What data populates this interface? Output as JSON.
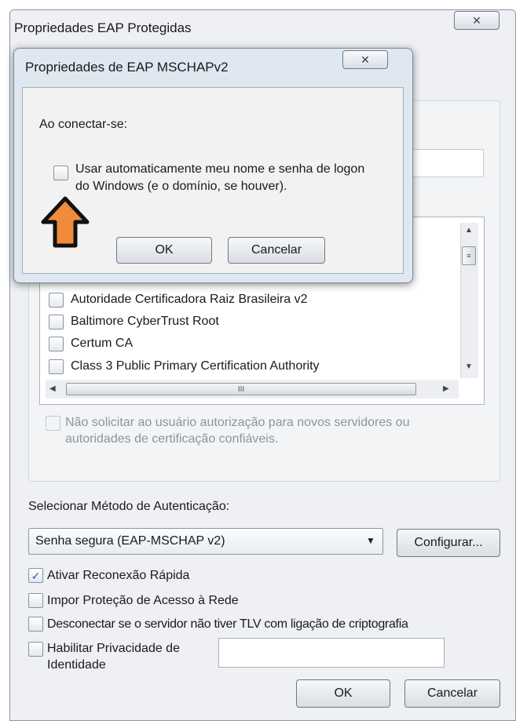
{
  "outer_dialog": {
    "title": "Propriedades EAP Protegidas",
    "close_glyph": "✕",
    "certificates": [
      {
        "label": "Autoridade Certificadora Raiz Brasileira v2",
        "checked": false
      },
      {
        "label": "Baltimore CyberTrust Root",
        "checked": false
      },
      {
        "label": "Certum CA",
        "checked": false
      },
      {
        "label": "Class 3 Public Primary Certification Authority",
        "checked": false
      }
    ],
    "hscroll_thumb_glyph": "III",
    "no_prompt_label": "Não solicitar ao usuário autorização para novos servidores ou autoridades de certificação confiáveis.",
    "auth_method_label": "Selecionar Método de Autenticação:",
    "auth_method_value": "Senha segura (EAP-MSCHAP v2)",
    "configure_label": "Configurar...",
    "options": {
      "fast_reconnect": {
        "label": "Ativar Reconexão Rápida",
        "checked": true
      },
      "enforce_nap": {
        "label": "Impor Proteção de Acesso à Rede",
        "checked": false
      },
      "disconnect_no_tlv": {
        "label": "Desconectar se o servidor não tiver TLV com ligação de criptografia",
        "checked": false
      },
      "identity_privacy": {
        "label": "Habilitar Privacidade de Identidade",
        "checked": false
      }
    },
    "identity_value": "",
    "ok_label": "OK",
    "cancel_label": "Cancelar"
  },
  "inner_dialog": {
    "title": "Propriedades de EAP MSCHAPv2",
    "close_glyph": "✕",
    "connect_label": "Ao conectar-se:",
    "auto_logon_label": "Usar automaticamente meu nome e senha de logon do Windows (e o domínio, se houver).",
    "auto_logon_checked": false,
    "ok_label": "OK",
    "cancel_label": "Cancelar"
  },
  "annotation": {
    "icon": "up-arrow-icon",
    "fill": "#f08a3c",
    "stroke": "#111111"
  },
  "colors": {
    "check_mark": "#2b5fb5",
    "window_bg": "#eef0f3",
    "dialog_bg": "#dfe7f1"
  }
}
